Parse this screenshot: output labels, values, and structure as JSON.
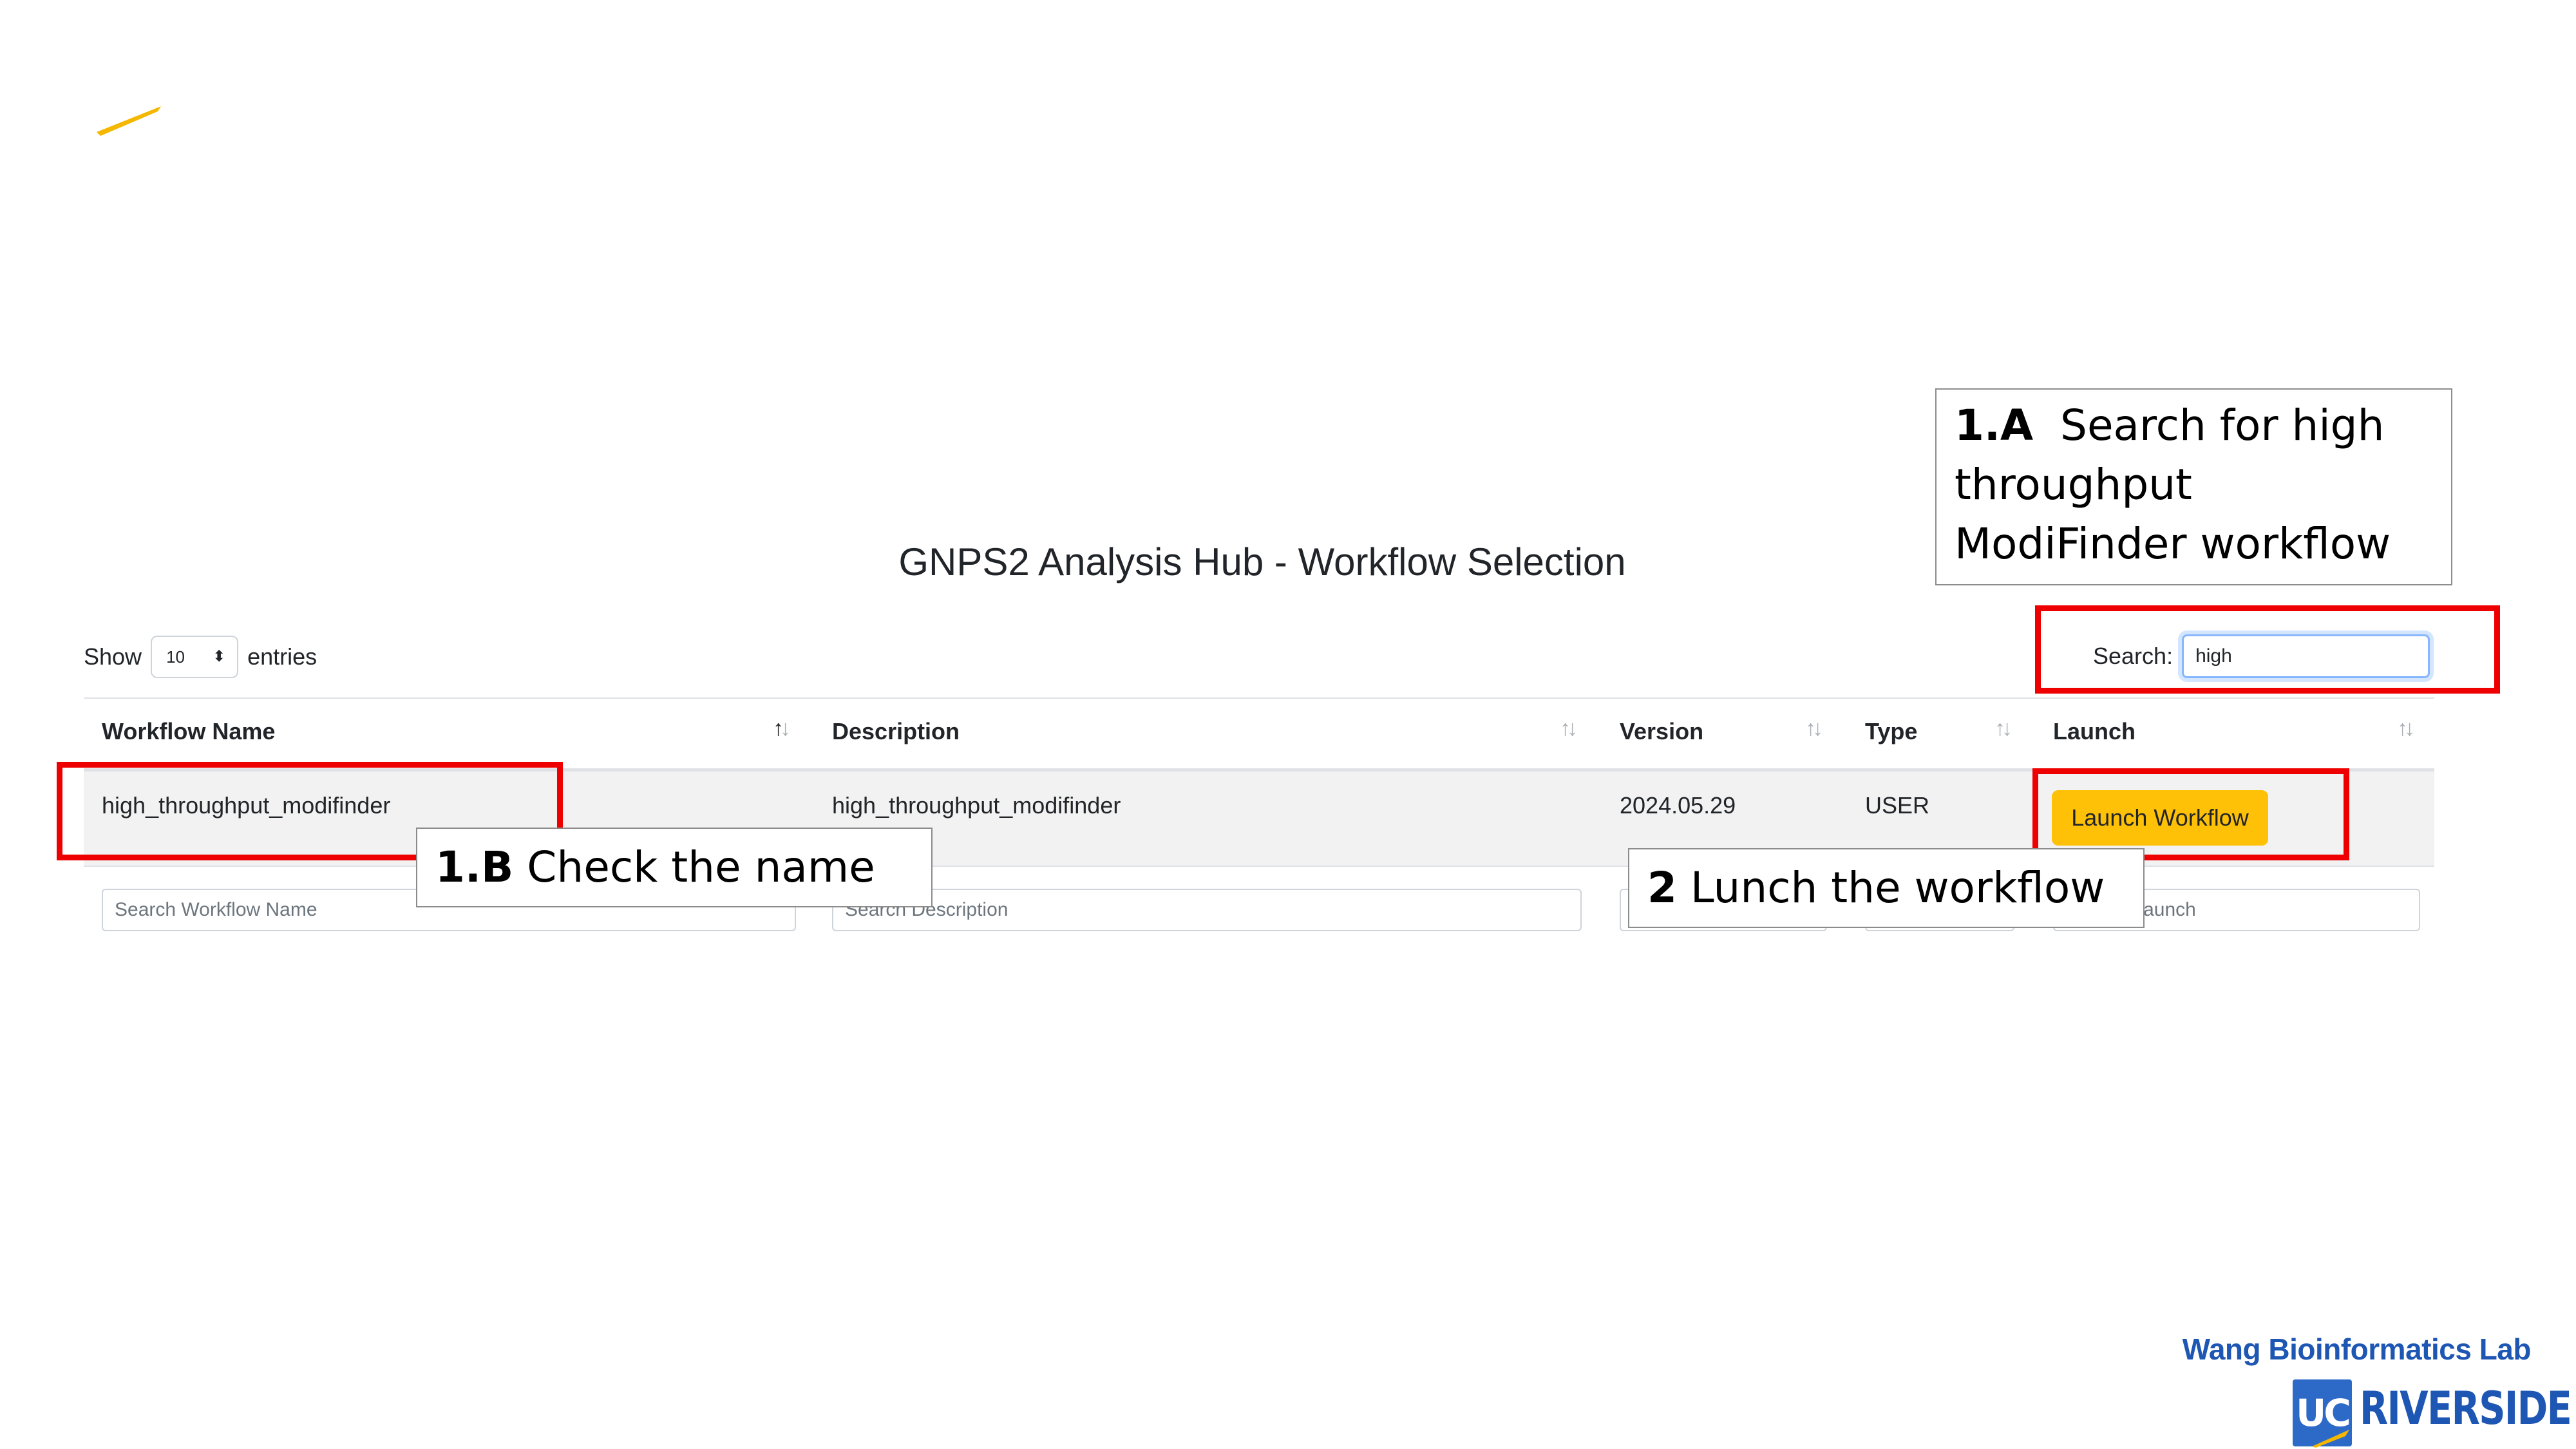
{
  "page": {
    "title": "GNPS2 Analysis Hub - Workflow Selection"
  },
  "length_control": {
    "show_label": "Show",
    "selected": "10",
    "entries_label": "entries"
  },
  "search": {
    "label": "Search:",
    "value": "high"
  },
  "table": {
    "columns": [
      {
        "label": "Workflow Name"
      },
      {
        "label": "Description"
      },
      {
        "label": "Version"
      },
      {
        "label": "Type"
      },
      {
        "label": "Launch"
      }
    ],
    "rows": [
      {
        "workflow_name": "high_throughput_modifinder",
        "description": "high_throughput_modifinder",
        "version": "2024.05.29",
        "type": "USER",
        "launch_label": "Launch Workflow"
      }
    ],
    "filters": {
      "workflow_name": "Search Workflow Name",
      "description": "Search Description",
      "launch": "Search Launch"
    }
  },
  "annotations": {
    "a_step": "1.A",
    "a_text": "Search for high throughput ModiFinder workflow",
    "b_step": "1.B",
    "b_text": "Check the name",
    "c_step": "2",
    "c_text": "Lunch the workflow"
  },
  "branding": {
    "lab_name": "Wang Bioinformatics Lab",
    "uc": "UC",
    "riverside": "RIVERSIDE",
    "colors": {
      "primary_blue": "#1e56b3",
      "gold": "#f5b800",
      "highlight_red": "#ee0000",
      "button_yellow": "#ffc107"
    }
  }
}
